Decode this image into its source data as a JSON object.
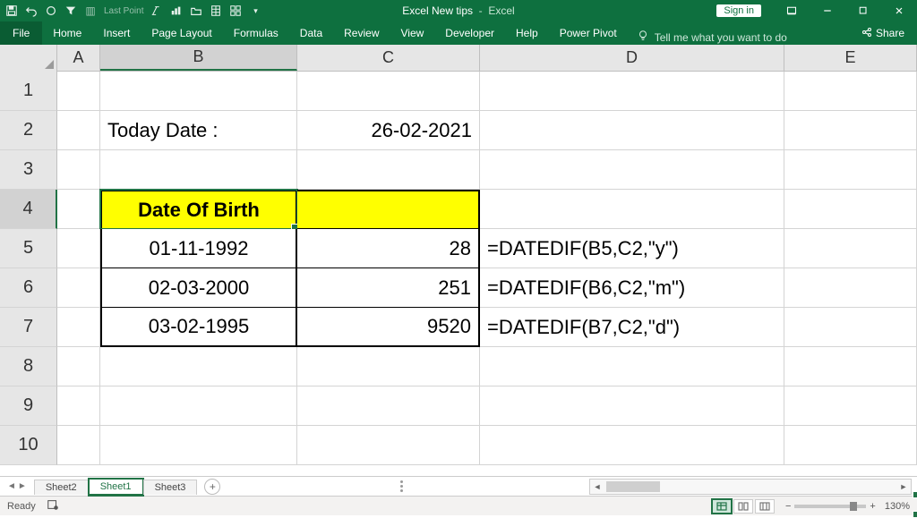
{
  "titlebar": {
    "doc": "Excel New tips",
    "app": "Excel",
    "signin": "Sign in"
  },
  "ribbon": {
    "file": "File",
    "tabs": [
      "Home",
      "Insert",
      "Page Layout",
      "Formulas",
      "Data",
      "Review",
      "View",
      "Developer",
      "Help",
      "Power Pivot"
    ],
    "tellme": "Tell me what you want to do",
    "share": "Share"
  },
  "columns": [
    "A",
    "B",
    "C",
    "D",
    "E"
  ],
  "rows": [
    "1",
    "2",
    "3",
    "4",
    "5",
    "6",
    "7",
    "8",
    "9",
    "10"
  ],
  "cells": {
    "B2": "Today Date : ",
    "C2": "26-02-2021",
    "B4": "Date Of Birth",
    "B5": "01-11-1992",
    "C5": "28",
    "D5": "=DATEDIF(B5,C2,\"y\")",
    "B6": "02-03-2000",
    "C6": "251",
    "D6": "=DATEDIF(B6,C2,\"m\")",
    "B7": "03-02-1995",
    "C7": "9520",
    "D7": "=DATEDIF(B7,C2,\"d\")"
  },
  "active_cell": "B4",
  "sheets": {
    "tabs": [
      "Sheet2",
      "Sheet1",
      "Sheet3"
    ],
    "active": "Sheet1"
  },
  "status": {
    "ready": "Ready",
    "zoom": "130%"
  }
}
